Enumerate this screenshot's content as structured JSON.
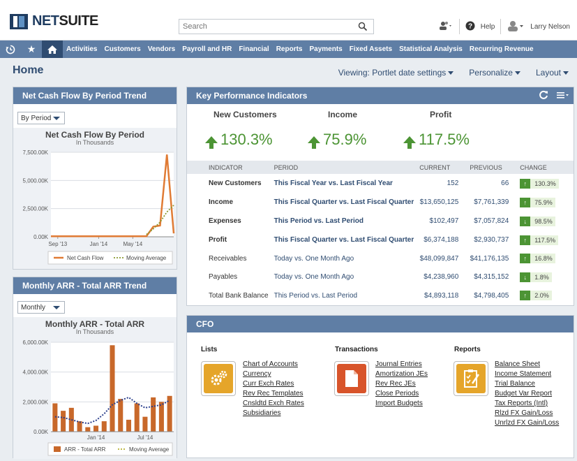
{
  "app": {
    "brand_bold": "NET",
    "brand_rest": "SUITE"
  },
  "search": {
    "placeholder": "Search"
  },
  "topbar": {
    "help_label": "Help",
    "user_name": "Larry Nelson"
  },
  "nav": {
    "items": [
      "Activities",
      "Customers",
      "Vendors",
      "Payroll and HR",
      "Financial",
      "Reports",
      "Payments",
      "Fixed Assets",
      "Statistical Analysis",
      "Recurring Revenue"
    ]
  },
  "page": {
    "title": "Home",
    "viewing_label": "Viewing: Portlet date settings",
    "personalize_label": "Personalize",
    "layout_label": "Layout"
  },
  "cashflow": {
    "portlet_title": "Net Cash Flow By Period Trend",
    "select_value": "By Period"
  },
  "arr": {
    "portlet_title": "Monthly ARR - Total ARR Trend",
    "select_value": "Monthly"
  },
  "chart_data": [
    {
      "type": "line",
      "title": "Net Cash Flow By Period",
      "subtitle": "In Thousands",
      "x_ticks": [
        "Sep '13",
        "Jan '14",
        "May '14"
      ],
      "y_ticks": [
        "7,500.00K",
        "5,000.00K",
        "2,500.00K",
        "0.00K"
      ],
      "ylim": [
        0,
        7500
      ],
      "grid": true,
      "legend_position": "bottom",
      "series": [
        {
          "name": "Net Cash Flow",
          "color": "#e07b34",
          "values": [
            50,
            50,
            50,
            50,
            50,
            50,
            50,
            50,
            50,
            50,
            50,
            50,
            50,
            50,
            50,
            900,
            1000,
            7300,
            300
          ]
        },
        {
          "name": "Moving Average",
          "color": "#8a9a30",
          "values": [
            null,
            null,
            null,
            null,
            null,
            null,
            null,
            null,
            null,
            null,
            null,
            null,
            null,
            null,
            200,
            700,
            1300,
            2200,
            2800
          ]
        }
      ]
    },
    {
      "type": "bar",
      "title": "Monthly ARR - Total ARR",
      "subtitle": "In Thousands",
      "x_ticks": [
        "Jan '14",
        "Jul '14"
      ],
      "y_ticks": [
        "6,000.00K",
        "4,000.00K",
        "2,000.00K",
        "0.00K"
      ],
      "ylim": [
        0,
        6000
      ],
      "grid": true,
      "legend_position": "bottom",
      "series": [
        {
          "name": "ARR - Total ARR",
          "color": "#c8682a",
          "values": [
            1900,
            1400,
            1600,
            700,
            300,
            400,
            700,
            5800,
            2200,
            800,
            1900,
            1000,
            2300,
            2000,
            2400
          ]
        },
        {
          "name": "Moving Average",
          "color": "#2b3f8c",
          "values": [
            1000,
            950,
            800,
            650,
            550,
            750,
            1200,
            1800,
            2100,
            2300,
            1900,
            1600,
            1700,
            1800,
            2100
          ]
        }
      ]
    }
  ],
  "kpi": {
    "portlet_title": "Key Performance Indicators",
    "summary": [
      {
        "label": "New Customers",
        "value": "130.3%"
      },
      {
        "label": "Income",
        "value": "75.9%"
      },
      {
        "label": "Profit",
        "value": "117.5%"
      }
    ],
    "headers": {
      "indicator": "INDICATOR",
      "period": "PERIOD",
      "current": "CURRENT",
      "previous": "PREVIOUS",
      "change": "CHANGE"
    },
    "rows": [
      {
        "indicator": "New Customers",
        "period": "This Fiscal Year vs. Last Fiscal Year",
        "current": "152",
        "previous": "66",
        "change": "130.3%",
        "dir": "up",
        "bold": true
      },
      {
        "indicator": "Income",
        "period": "This Fiscal Quarter vs. Last Fiscal Quarter",
        "current": "$13,650,125",
        "previous": "$7,761,339",
        "change": "75.9%",
        "dir": "up",
        "bold": true
      },
      {
        "indicator": "Expenses",
        "period": "This Period vs. Last Period",
        "current": "$102,497",
        "previous": "$7,057,824",
        "change": "98.5%",
        "dir": "down",
        "bold": true
      },
      {
        "indicator": "Profit",
        "period": "This Fiscal Quarter vs. Last Fiscal Quarter",
        "current": "$6,374,188",
        "previous": "$2,930,737",
        "change": "117.5%",
        "dir": "up",
        "bold": true
      },
      {
        "indicator": "Receivables",
        "period": "Today vs. One Month Ago",
        "current": "$48,099,847",
        "previous": "$41,176,135",
        "change": "16.8%",
        "dir": "up",
        "bold": false
      },
      {
        "indicator": "Payables",
        "period": "Today vs. One Month Ago",
        "current": "$4,238,960",
        "previous": "$4,315,152",
        "change": "1.8%",
        "dir": "down",
        "bold": false
      },
      {
        "indicator": "Total Bank Balance",
        "period": "This Period vs. Last Period",
        "current": "$4,893,118",
        "previous": "$4,798,405",
        "change": "2.0%",
        "dir": "up",
        "bold": false
      }
    ]
  },
  "cfo": {
    "portlet_title": "CFO",
    "lists": {
      "heading": "Lists",
      "links": [
        "Chart of Accounts",
        "Currency",
        "Curr Exch Rates",
        "Rev Rec Templates",
        "Cnsldtd Exch Rates",
        "Subsidiaries"
      ]
    },
    "transactions": {
      "heading": "Transactions",
      "links": [
        "Journal Entries",
        "Amortization JEs",
        "Rev Rec JEs",
        "Close Periods",
        "Import Budgets"
      ]
    },
    "reports": {
      "heading": "Reports",
      "links": [
        "Balance Sheet",
        "Income Statement",
        "Trial Balance",
        "Budget Var Report",
        "Tax Reports (Intl)",
        "Rlzd FX Gain/Loss",
        "Unrlzd FX Gain/Loss"
      ]
    }
  },
  "colors": {
    "nav": "#5f7ea5",
    "nav_active": "#2f4c71",
    "positive": "#4c9434"
  }
}
